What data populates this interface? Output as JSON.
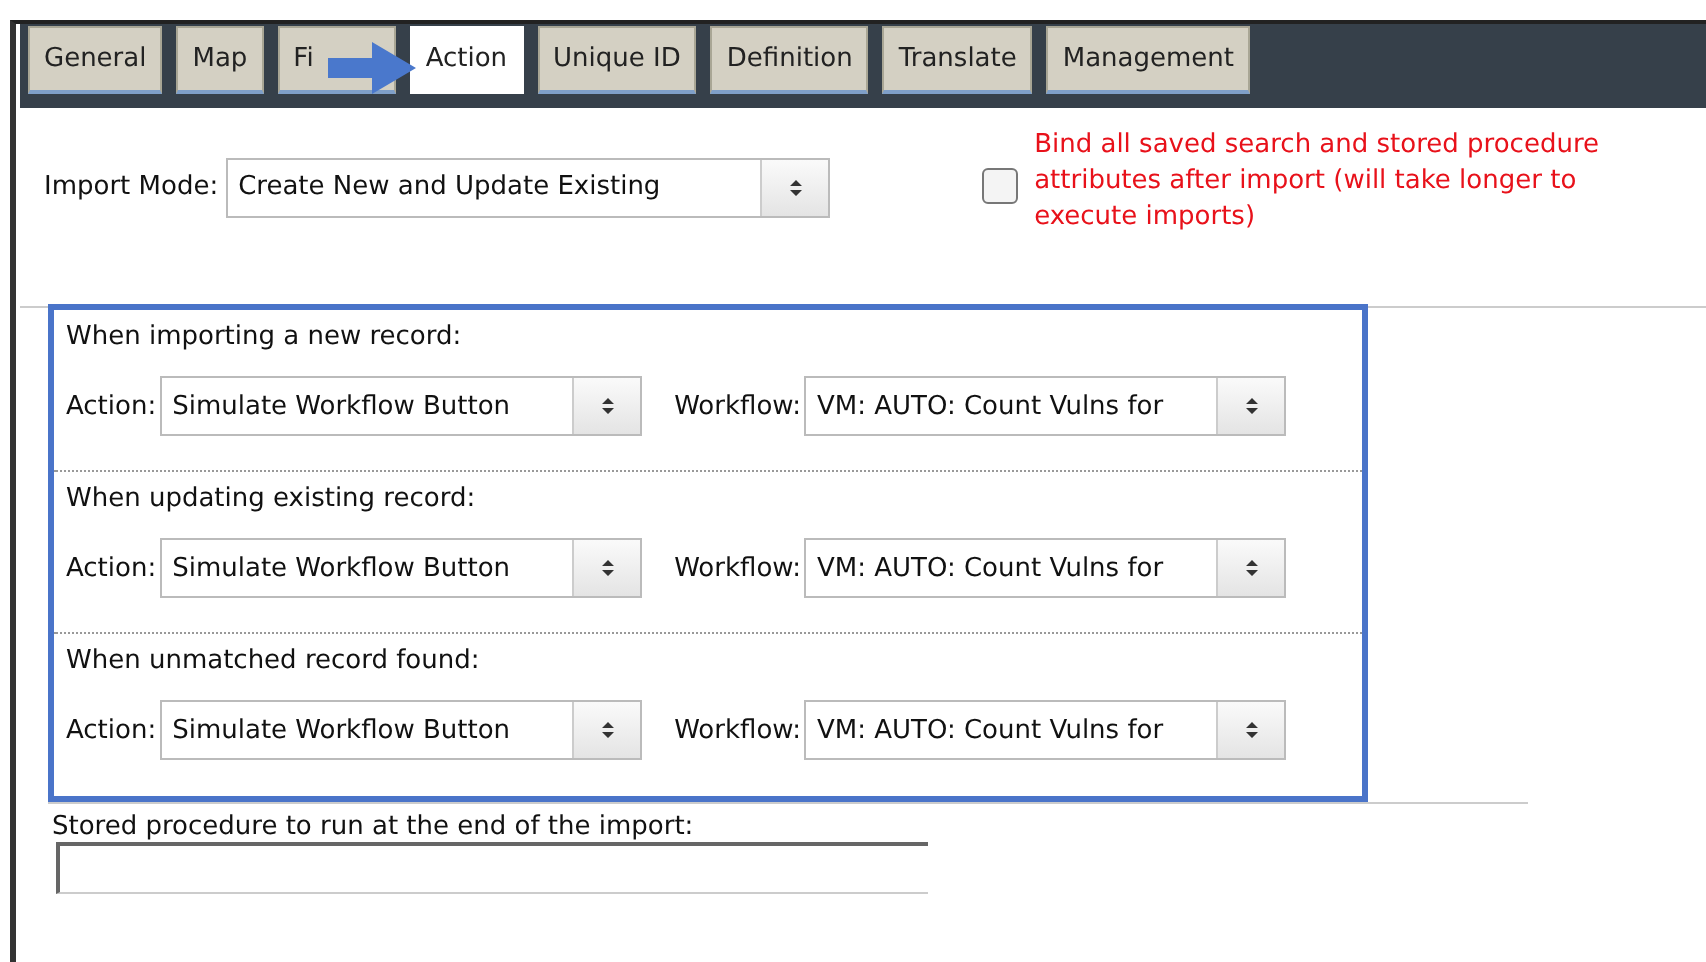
{
  "tabs": [
    {
      "label": "General",
      "selected": false
    },
    {
      "label": "Map",
      "selected": false
    },
    {
      "label": "Fi",
      "selected": false
    },
    {
      "label": "Action",
      "selected": true
    },
    {
      "label": "Unique ID",
      "selected": false
    },
    {
      "label": "Definition",
      "selected": false
    },
    {
      "label": "Translate",
      "selected": false
    },
    {
      "label": "Management",
      "selected": false
    }
  ],
  "import_mode": {
    "label": "Import Mode:",
    "value": "Create New and Update Existing"
  },
  "bind_option": {
    "checked": false,
    "text": "Bind all saved search and stored procedure\nattributes after import (will take longer to\nexecute imports)"
  },
  "sections": [
    {
      "heading": "When importing a new record:",
      "action_label": "Action:",
      "action_value": "Simulate Workflow Button",
      "workflow_label": "Workflow:",
      "workflow_value": "VM: AUTO: Count Vulns for"
    },
    {
      "heading": "When updating existing record:",
      "action_label": "Action:",
      "action_value": "Simulate Workflow Button",
      "workflow_label": "Workflow:",
      "workflow_value": "VM: AUTO: Count Vulns for"
    },
    {
      "heading": "When unmatched record found:",
      "action_label": "Action:",
      "action_value": "Simulate Workflow Button",
      "workflow_label": "Workflow:",
      "workflow_value": "VM: AUTO: Count Vulns for"
    }
  ],
  "stored_procedure": {
    "label": "Stored procedure to run at the end of the import:"
  }
}
